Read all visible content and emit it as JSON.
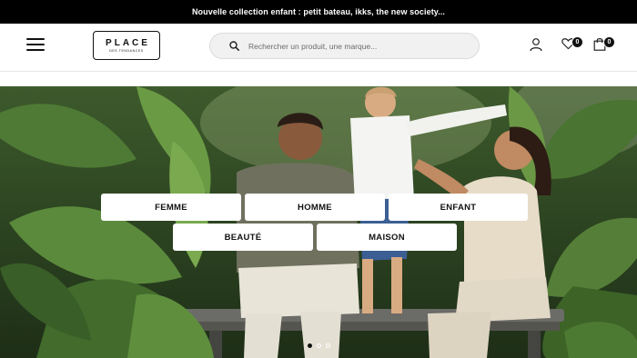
{
  "promo": {
    "text": "Nouvelle collection enfant : petit bateau, ikks, the new society..."
  },
  "header": {
    "logo": {
      "main": "PLACE",
      "sub": "DES TENDANCES"
    },
    "search": {
      "placeholder": "Rechercher un produit, une marque..."
    },
    "wishlist_count": "0",
    "cart_count": "0"
  },
  "icons": [
    "menu-icon",
    "search-icon",
    "user-icon",
    "heart-icon",
    "bag-icon"
  ],
  "categories": [
    {
      "label": "FEMME"
    },
    {
      "label": "HOMME"
    },
    {
      "label": "ENFANT"
    },
    {
      "label": "BEAUTÉ"
    },
    {
      "label": "MAISON"
    }
  ],
  "carousel": {
    "slides": 3,
    "active_index": 0
  },
  "colors": {
    "promo_bg": "#000000",
    "search_bg": "#f1f1f1",
    "badge_bg": "#111111"
  }
}
